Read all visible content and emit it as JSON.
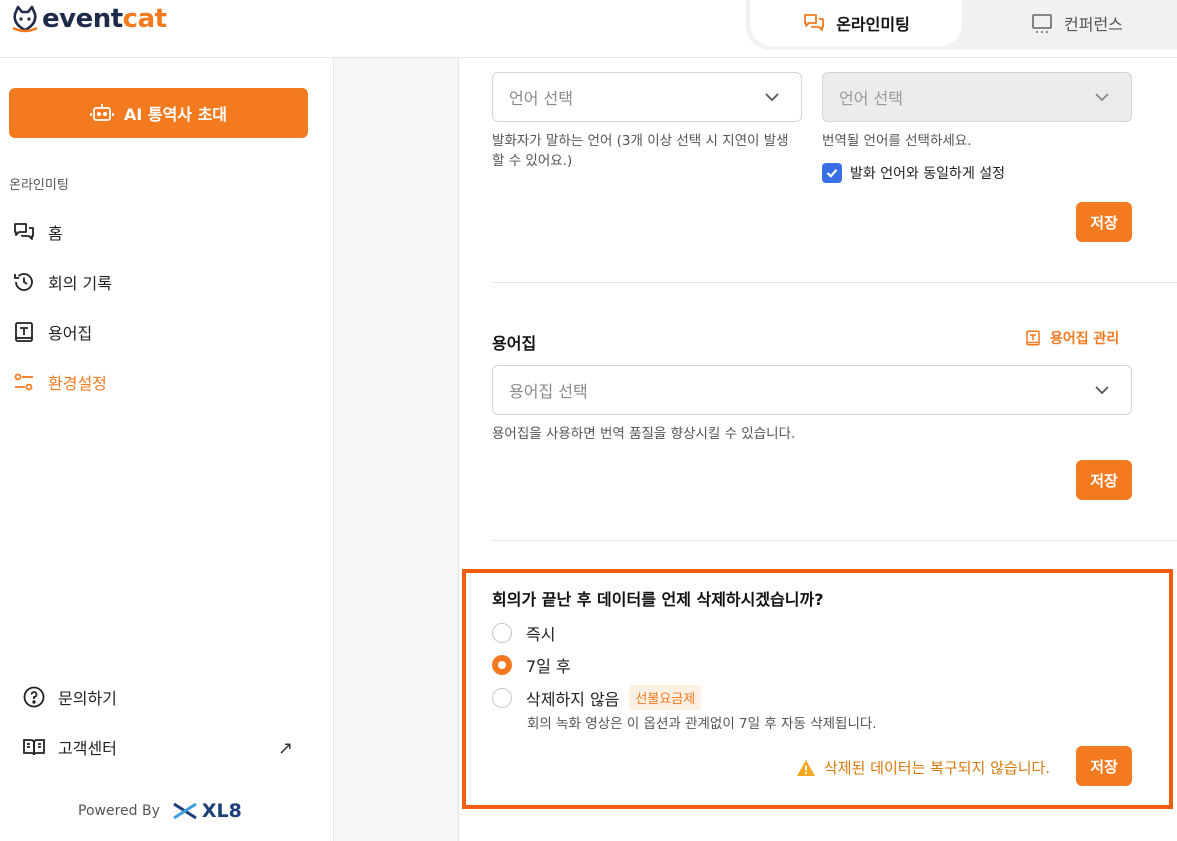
{
  "app": {
    "logo_part1": "event",
    "logo_part2": "cat"
  },
  "mode_tabs": [
    {
      "label": "온라인미팅",
      "active": true
    },
    {
      "label": "컨퍼런스",
      "active": false
    }
  ],
  "sidebar": {
    "invite_button": "AI 통역사 초대",
    "section_label": "온라인미팅",
    "items": [
      {
        "label": "홈",
        "icon": "chat-icon"
      },
      {
        "label": "회의 기록",
        "icon": "history-icon"
      },
      {
        "label": "용어집",
        "icon": "glossary-icon"
      },
      {
        "label": "환경설정",
        "icon": "settings-sliders-icon",
        "active": true
      }
    ],
    "bottom_items": [
      {
        "label": "문의하기",
        "icon": "help-circle-icon"
      },
      {
        "label": "고객센터",
        "icon": "book-open-icon"
      }
    ],
    "external_arrow": "↗",
    "powered_by": "Powered By",
    "powered_brand": "XL8"
  },
  "language": {
    "source_placeholder": "언어 선택",
    "source_help": "발화자가 말하는 언어 (3개 이상 선택 시 지연이 발생할 수 있어요.)",
    "source_help_line1": "발화자가 말하는 언어 (3개 이상 선택 시 지연이 발생",
    "source_help_line2": "할 수 있어요.)",
    "target_placeholder": "언어 선택",
    "target_help": "번역될 언어를 선택하세요.",
    "same_as_source_label": "발화 언어와 동일하게 설정",
    "same_as_source_checked": true,
    "save": "저장"
  },
  "glossary": {
    "title": "용어집",
    "manage_link": "용어집 관리",
    "placeholder": "용어집 선택",
    "help": "용어집을 사용하면 번역 품질을 향상시킬 수 있습니다.",
    "save": "저장"
  },
  "retention": {
    "question": "회의가 끝난 후 데이터를 언제 삭제하시겠습니까?",
    "options": [
      {
        "label": "즉시",
        "selected": false
      },
      {
        "label": "7일 후",
        "selected": true
      },
      {
        "label": "삭제하지 않음",
        "selected": false,
        "badge": "선불요금제"
      }
    ],
    "note": "회의 녹화 영상은 이 옵션과 관계없이 7일 후 자동 삭제됩니다.",
    "warning": "삭제된 데이터는 복구되지 않습니다.",
    "save": "저장"
  },
  "colors": {
    "accent": "#f47a1f",
    "highlight_border": "#f45d0f",
    "checkbox": "#3a6ee8",
    "warning": "#d9770a",
    "brand_navy": "#1e2a4a"
  }
}
